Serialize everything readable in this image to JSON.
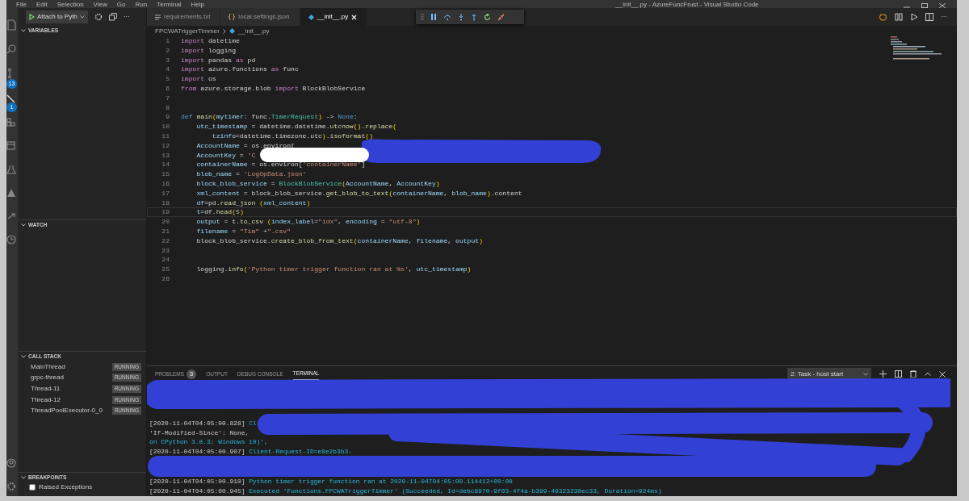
{
  "title_bar": {
    "menu": [
      "File",
      "Edit",
      "Selection",
      "View",
      "Go",
      "Run",
      "Terminal",
      "Help"
    ],
    "title": "__init__.py - AzureFuncFrust - Visual Studio Code"
  },
  "activity_bar": {
    "badges": [
      "13",
      "1"
    ]
  },
  "sidebar": {
    "launch_config": "Attach to Pyth",
    "more": "···",
    "sections": [
      {
        "kind": "variables",
        "title": "VARIABLES"
      },
      {
        "kind": "watch",
        "title": "WATCH"
      },
      {
        "kind": "callstack",
        "title": "CALL STACK",
        "threads": [
          {
            "name": "MainThread",
            "state": "RUNNING"
          },
          {
            "name": "grpc-thread",
            "state": "RUNNING"
          },
          {
            "name": "Thread-11",
            "state": "RUNNING"
          },
          {
            "name": "Thread-12",
            "state": "RUNNING"
          },
          {
            "name": "ThreadPoolExecutor-0_0",
            "state": "RUNNING"
          }
        ]
      },
      {
        "kind": "breakpoints",
        "title": "BREAKPOINTS",
        "items": [
          {
            "label": "Raised Exceptions",
            "checked": false
          }
        ]
      }
    ]
  },
  "tabs": [
    {
      "label": "requirements.txt",
      "kind": "text",
      "selected": false
    },
    {
      "label": "local.settings.json",
      "kind": "json",
      "selected": false
    },
    {
      "label": "__init__.py",
      "kind": "python",
      "selected": true
    }
  ],
  "editor_actions_more": "···",
  "breadcrumbs": [
    "FPCWATriggerTimmer",
    "__init__.py"
  ],
  "code": [
    {
      "n": "1",
      "current": false,
      "tokens": [
        {
          "kind": "kw",
          "text": "import"
        },
        {
          "kind": "pl",
          "text": " datetime"
        }
      ]
    },
    {
      "n": "2",
      "current": false,
      "tokens": [
        {
          "kind": "kw",
          "text": "import"
        },
        {
          "kind": "pl",
          "text": " logging"
        }
      ]
    },
    {
      "n": "3",
      "current": false,
      "tokens": [
        {
          "kind": "kw",
          "text": "import"
        },
        {
          "kind": "pl",
          "text": " pandas "
        },
        {
          "kind": "kw",
          "text": "as"
        },
        {
          "kind": "pl",
          "text": " pd"
        }
      ]
    },
    {
      "n": "4",
      "current": false,
      "tokens": [
        {
          "kind": "kw",
          "text": "import"
        },
        {
          "kind": "pl",
          "text": " azure.functions "
        },
        {
          "kind": "kw",
          "text": "as"
        },
        {
          "kind": "pl",
          "text": " func"
        }
      ]
    },
    {
      "n": "5",
      "current": false,
      "tokens": [
        {
          "kind": "kw",
          "text": "import"
        },
        {
          "kind": "pl",
          "text": " os"
        }
      ]
    },
    {
      "n": "6",
      "current": false,
      "tokens": [
        {
          "kind": "kw",
          "text": "from"
        },
        {
          "kind": "pl",
          "text": " azure.storage.blob "
        },
        {
          "kind": "kw",
          "text": "import"
        },
        {
          "kind": "pl",
          "text": " BlockBlobService"
        }
      ]
    },
    {
      "n": "7",
      "current": false
    },
    {
      "n": "8",
      "current": false
    },
    {
      "n": "9",
      "current": false,
      "tokens": [
        {
          "kind": "def",
          "text": "def"
        },
        {
          "kind": "fn",
          "text": " main"
        },
        {
          "kind": "br",
          "text": "("
        },
        {
          "kind": "var",
          "text": "mytimer"
        },
        {
          "kind": "pl",
          "text": ": func."
        },
        {
          "kind": "cls",
          "text": "TimerRequest"
        },
        {
          "kind": "br",
          "text": ")"
        },
        {
          "kind": "pl",
          "text": " -> "
        },
        {
          "kind": "def",
          "text": "None"
        },
        {
          "kind": "pl",
          "text": ":"
        }
      ]
    },
    {
      "n": "10",
      "current": false,
      "tokens": [
        {
          "kind": "var",
          "text": "    utc_timestamp"
        },
        {
          "kind": "pl",
          "text": " = datetime.datetime."
        },
        {
          "kind": "fn",
          "text": "utcnow"
        },
        {
          "kind": "br",
          "text": "()"
        },
        {
          "kind": "pl",
          "text": "."
        },
        {
          "kind": "fn",
          "text": "replace"
        },
        {
          "kind": "br",
          "text": "("
        }
      ]
    },
    {
      "n": "11",
      "current": false,
      "tokens": [
        {
          "kind": "var",
          "text": "        tzinfo"
        },
        {
          "kind": "pl",
          "text": "=datetime.timezone.utc"
        },
        {
          "kind": "br",
          "text": ")"
        },
        {
          "kind": "pl",
          "text": "."
        },
        {
          "kind": "fn",
          "text": "isoformat"
        },
        {
          "kind": "br",
          "text": "()"
        }
      ]
    },
    {
      "n": "12",
      "current": false,
      "tokens": [
        {
          "kind": "var",
          "text": "    AccountName"
        },
        {
          "kind": "pl",
          "text": " = os.environ["
        }
      ]
    },
    {
      "n": "13",
      "current": false,
      "tokens": [
        {
          "kind": "var",
          "text": "    AccountKey"
        },
        {
          "kind": "pl",
          "text": " = "
        },
        {
          "kind": "str",
          "text": "'C"
        }
      ]
    },
    {
      "n": "14",
      "current": false,
      "tokens": [
        {
          "kind": "var",
          "text": "    containerName"
        },
        {
          "kind": "pl",
          "text": " = os.environ["
        },
        {
          "kind": "str",
          "text": "'containerName'"
        },
        {
          "kind": "pl",
          "text": "]"
        }
      ]
    },
    {
      "n": "15",
      "current": false,
      "tokens": [
        {
          "kind": "var",
          "text": "    blob_name"
        },
        {
          "kind": "pl",
          "text": " = "
        },
        {
          "kind": "str",
          "text": "'LogOpData.json'"
        }
      ]
    },
    {
      "n": "16",
      "current": false,
      "tokens": [
        {
          "kind": "var",
          "text": "    block_blob_service"
        },
        {
          "kind": "pl",
          "text": " = "
        },
        {
          "kind": "cls",
          "text": "BlockBlobService"
        },
        {
          "kind": "br",
          "text": "("
        },
        {
          "kind": "var",
          "text": "AccountName"
        },
        {
          "kind": "pl",
          "text": ", "
        },
        {
          "kind": "var",
          "text": "AccountKey"
        },
        {
          "kind": "br",
          "text": ")"
        }
      ]
    },
    {
      "n": "17",
      "current": false,
      "tokens": [
        {
          "kind": "var",
          "text": "    xml_content"
        },
        {
          "kind": "pl",
          "text": " = block_blob_service."
        },
        {
          "kind": "fn",
          "text": "get_blob_to_text"
        },
        {
          "kind": "br",
          "text": "("
        },
        {
          "kind": "var",
          "text": "containerName"
        },
        {
          "kind": "pl",
          "text": ", "
        },
        {
          "kind": "var",
          "text": "blob_name"
        },
        {
          "kind": "br",
          "text": ")"
        },
        {
          "kind": "pl",
          "text": ".content"
        }
      ]
    },
    {
      "n": "18",
      "current": false,
      "tokens": [
        {
          "kind": "var",
          "text": "    df"
        },
        {
          "kind": "pl",
          "text": "=pd."
        },
        {
          "kind": "fn",
          "text": "read_json"
        },
        {
          "kind": "br",
          "text": " ("
        },
        {
          "kind": "var",
          "text": "xml_content"
        },
        {
          "kind": "br",
          "text": ")"
        }
      ]
    },
    {
      "n": "19",
      "current": true,
      "tokens": [
        {
          "kind": "var",
          "text": "    t"
        },
        {
          "kind": "pl",
          "text": "=df."
        },
        {
          "kind": "fn",
          "text": "head"
        },
        {
          "kind": "br",
          "text": "("
        },
        {
          "kind": "num",
          "text": "5"
        },
        {
          "kind": "br",
          "text": ")"
        }
      ]
    },
    {
      "n": "20",
      "current": false,
      "tokens": [
        {
          "kind": "var",
          "text": "    output"
        },
        {
          "kind": "pl",
          "text": " = t."
        },
        {
          "kind": "fn",
          "text": "to_csv"
        },
        {
          "kind": "br",
          "text": " ("
        },
        {
          "kind": "var",
          "text": "index_label"
        },
        {
          "kind": "pl",
          "text": "="
        },
        {
          "kind": "str",
          "text": "\"idx\""
        },
        {
          "kind": "pl",
          "text": ", "
        },
        {
          "kind": "var",
          "text": "encoding"
        },
        {
          "kind": "pl",
          "text": " = "
        },
        {
          "kind": "str",
          "text": "\"utf-8\""
        },
        {
          "kind": "br",
          "text": ")"
        }
      ]
    },
    {
      "n": "21",
      "current": false,
      "tokens": [
        {
          "kind": "var",
          "text": "    filename"
        },
        {
          "kind": "pl",
          "text": " = "
        },
        {
          "kind": "str",
          "text": "\"Tim\""
        },
        {
          "kind": "pl",
          "text": " +"
        },
        {
          "kind": "str",
          "text": "\".csv\""
        }
      ]
    },
    {
      "n": "22",
      "current": false,
      "tokens": [
        {
          "kind": "pl",
          "text": "    block_blob_service."
        },
        {
          "kind": "fn",
          "text": "create_blob_from_text"
        },
        {
          "kind": "br",
          "text": "("
        },
        {
          "kind": "var",
          "text": "containerName"
        },
        {
          "kind": "pl",
          "text": ", "
        },
        {
          "kind": "var",
          "text": "filename"
        },
        {
          "kind": "pl",
          "text": ", "
        },
        {
          "kind": "var",
          "text": "output"
        },
        {
          "kind": "br",
          "text": ")"
        }
      ]
    },
    {
      "n": "23",
      "current": false
    },
    {
      "n": "24",
      "current": false
    },
    {
      "n": "25",
      "current": false,
      "tokens": [
        {
          "kind": "pl",
          "text": "    logging."
        },
        {
          "kind": "fn",
          "text": "info"
        },
        {
          "kind": "br",
          "text": "("
        },
        {
          "kind": "str",
          "text": "'Python timer trigger function ran at %s'"
        },
        {
          "kind": "pl",
          "text": ", "
        },
        {
          "kind": "var",
          "text": "utc_timestamp"
        },
        {
          "kind": "br",
          "text": ")"
        }
      ]
    },
    {
      "n": "26",
      "current": false
    }
  ],
  "panel": {
    "tabs": [
      {
        "label": "PROBLEMS",
        "count": "3",
        "selected": false
      },
      {
        "label": "OUTPUT",
        "selected": false
      },
      {
        "label": "DEBUG CONSOLE",
        "selected": false
      },
      {
        "label": "TERMINAL",
        "selected": true
      }
    ],
    "terminal_select": "2: Task - host start",
    "terminal_blocks": [
      {
        "lines": [
          [
            {
              "kind": "ts",
              "text": "[2020-11-04T04:05:00.828]"
            },
            {
              "kind": "msg",
              "text": " Cl"
            }
          ],
          [
            {
              "kind": "ts",
              "text": "'If-Modified-Since': None,"
            }
          ],
          [
            {
              "kind": "msg",
              "text": "on CPython 3.8.3; Windows 10)',"
            }
          ],
          [
            {
              "kind": "ts",
              "text": "[2020-11-04T04:05:00.907]"
            },
            {
              "kind": "msg",
              "text": " Client-Request-ID=e8e2b3b3-"
            }
          ]
        ]
      },
      {
        "lines": [
          [
            {
              "kind": "ts",
              "text": "[2020-11-04T04:05:00.910]"
            },
            {
              "kind": "msg",
              "text": " Python timer trigger function ran at 2020-11-04T04:05:00.114412+00:00"
            }
          ],
          [
            {
              "kind": "ts",
              "text": "[2020-11-04T04:05:00.945]"
            },
            {
              "kind": "msg",
              "text": " Executed 'Functions.FPCWATriggerTimmer' (Succeeded, Id=debc8970-9f63-4f4a-b399-49323230ec33, Duration=924ms)"
            }
          ]
        ]
      }
    ]
  }
}
